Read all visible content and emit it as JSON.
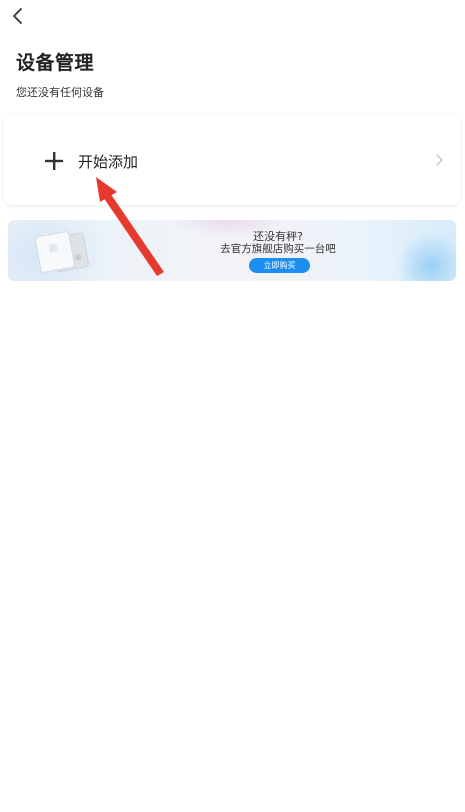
{
  "header": {
    "title": "设备管理",
    "subtitle": "您还没有任何设备"
  },
  "add_card": {
    "label": "开始添加"
  },
  "banner": {
    "title": "还没有秤?",
    "text": "去官方旗舰店购买一台吧",
    "button_label": "立即购买"
  },
  "icons": {
    "back": "back-arrow-icon",
    "plus": "plus-icon",
    "chevron": "chevron-right-icon",
    "product": "smart-scale-image"
  },
  "colors": {
    "accent": "#1a8ff0",
    "annotation": "#e8392f"
  }
}
